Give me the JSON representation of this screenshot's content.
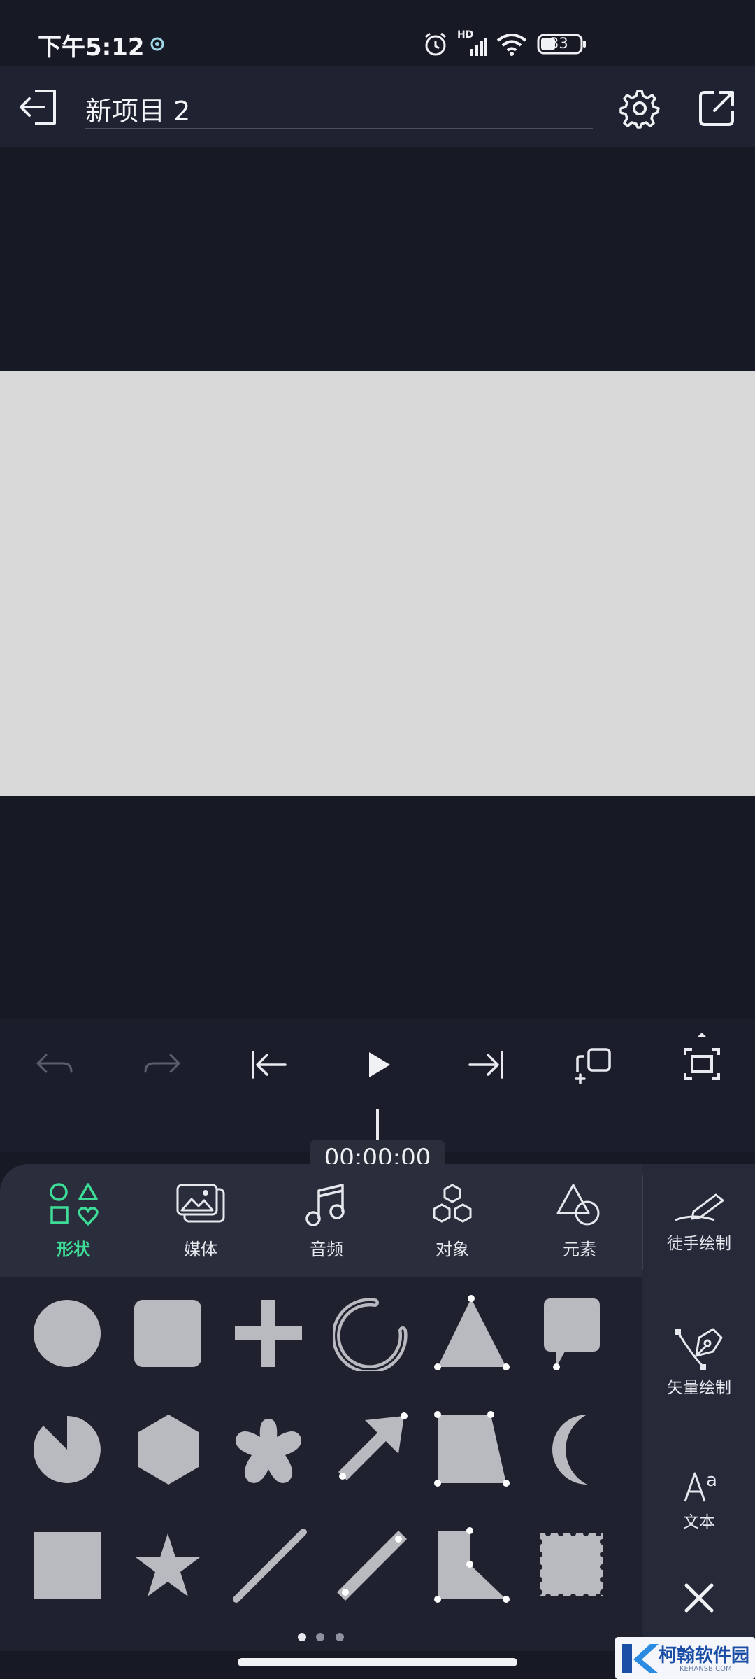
{
  "status_bar": {
    "time": "下午5:12",
    "network": "HD",
    "battery": "33",
    "icons": [
      "app-notification-icon",
      "alarm-icon",
      "signal-icon",
      "wifi-icon",
      "battery-icon"
    ]
  },
  "header": {
    "title": "新项目 2",
    "icons": [
      "exit-icon",
      "settings-icon",
      "export-icon"
    ]
  },
  "playback": {
    "timecode": "00:00:00",
    "icons": [
      "undo-icon",
      "redo-icon",
      "skip-to-start-icon",
      "play-icon",
      "skip-to-end-icon",
      "duplicate-icon",
      "fullscreen-icon"
    ]
  },
  "categories": [
    {
      "label": "形状",
      "icon": "shapes-icon",
      "active": true
    },
    {
      "label": "媒体",
      "icon": "media-icon",
      "active": false
    },
    {
      "label": "音频",
      "icon": "music-icon",
      "active": false
    },
    {
      "label": "对象",
      "icon": "objects-icon",
      "active": false
    },
    {
      "label": "元素",
      "icon": "elements-icon",
      "active": false
    }
  ],
  "side_tools": [
    {
      "label": "徒手绘制",
      "icon": "freehand-draw-icon"
    },
    {
      "label": "矢量绘制",
      "icon": "vector-pen-icon"
    },
    {
      "label": "文本",
      "icon": "text-icon"
    }
  ],
  "close_icon": "close-icon",
  "shapes": [
    [
      "circle",
      "rounded-square",
      "plus",
      "ring",
      "triangle",
      "speech-bubble"
    ],
    [
      "pie",
      "hexagon",
      "flower",
      "arrow",
      "trapezoid",
      "crescent"
    ],
    [
      "square",
      "star",
      "line",
      "thick-line",
      "l-shape",
      "stamp"
    ]
  ],
  "pagination": {
    "pages": 3,
    "current": 1
  },
  "colors": {
    "accent": "#3ddc97",
    "shape_fill": "#b8bac0",
    "canvas": "#d9d9d9"
  },
  "watermark": {
    "text": "柯翰软件园",
    "sub": "KEHANSB.COM"
  }
}
